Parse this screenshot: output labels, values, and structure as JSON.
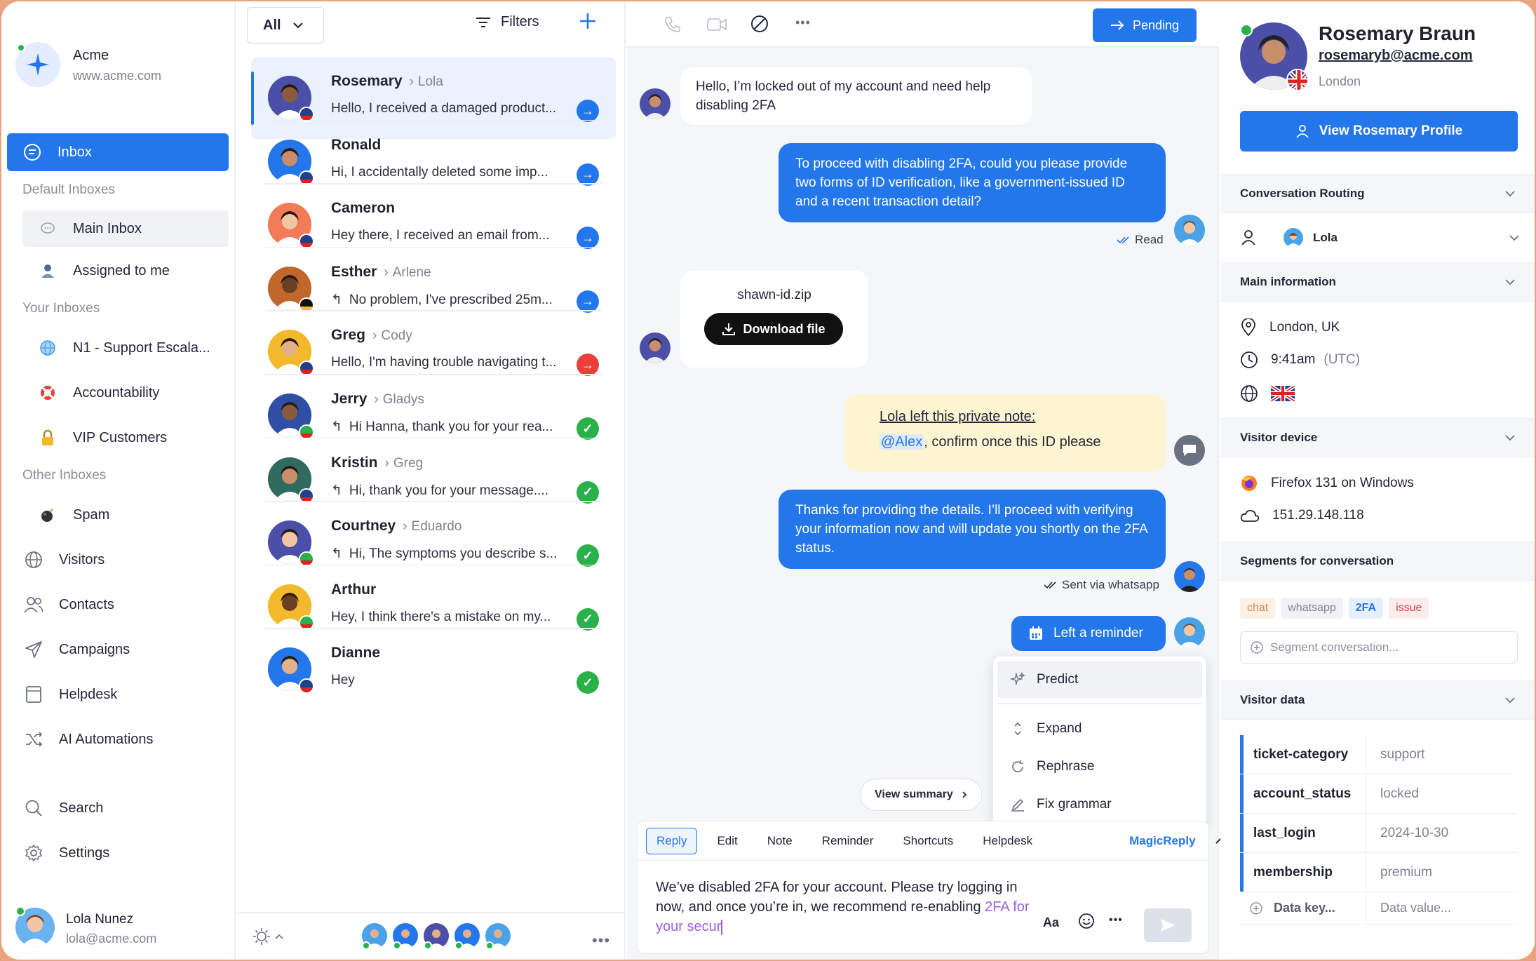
{
  "workspace": {
    "name": "Acme",
    "url": "www.acme.com"
  },
  "sidebar": {
    "inbox_label": "Inbox",
    "default_inboxes_title": "Default Inboxes",
    "main_inbox": "Main Inbox",
    "assigned_to_me": "Assigned to me",
    "your_inboxes_title": "Your Inboxes",
    "your_inboxes": [
      "N1 - Support Escala...",
      "Accountability",
      "VIP Customers"
    ],
    "other_inboxes_title": "Other Inboxes",
    "spam": "Spam",
    "nav": [
      "Visitors",
      "Contacts",
      "Campaigns",
      "Helpdesk",
      "AI Automations"
    ],
    "search": "Search",
    "settings": "Settings",
    "user": {
      "name": "Lola Nunez",
      "email": "lola@acme.com"
    }
  },
  "list": {
    "filter_value": "All",
    "filters_label": "Filters",
    "conversations": [
      {
        "name": "Rosemary",
        "agent": "Lola",
        "preview": "Hello, I received a damaged product...",
        "status": "arrow-blue",
        "reply": false
      },
      {
        "name": "Ronald",
        "agent": "",
        "preview": "Hi, I accidentally deleted some imp...",
        "status": "arrow-blue",
        "reply": false
      },
      {
        "name": "Cameron",
        "agent": "",
        "preview": "Hey there, I received an email from...",
        "status": "arrow-blue",
        "reply": false
      },
      {
        "name": "Esther",
        "agent": "Arlene",
        "preview": "No problem, I've prescribed 25m...",
        "status": "arrow-blue",
        "reply": true
      },
      {
        "name": "Greg",
        "agent": "Cody",
        "preview": "Hello, I'm having trouble navigating t...",
        "status": "arrow-red",
        "reply": false
      },
      {
        "name": "Jerry",
        "agent": "Gladys",
        "preview": "Hi Hanna, thank you for your rea...",
        "status": "check-green",
        "reply": true
      },
      {
        "name": "Kristin",
        "agent": "Greg",
        "preview": "Hi, thank you for your message....",
        "status": "check-green",
        "reply": true
      },
      {
        "name": "Courtney",
        "agent": "Eduardo",
        "preview": "Hi, The symptoms you describe s...",
        "status": "check-green",
        "reply": true
      },
      {
        "name": "Arthur",
        "agent": "",
        "preview": "Hey, I think there's a mistake on my...",
        "status": "check-green",
        "reply": false
      },
      {
        "name": "Dianne",
        "agent": "",
        "preview": "Hey",
        "status": "check-green",
        "reply": false
      }
    ]
  },
  "chat": {
    "pending_label": "Pending",
    "msg1": "Hello, I’m locked out of my account and need help disabling 2FA",
    "msg2": "To proceed with disabling 2FA, could you please provide two forms of ID verification, like a government-issued ID and a recent transaction detail?",
    "msg2_status": "Read",
    "file_name": "shawn-id.zip",
    "download_label": "Download file",
    "note_title": "Lola left this private note:",
    "note_mention": "@Alex",
    "note_text": ", confirm once this ID please",
    "msg3": "Thanks for providing the details. I’ll proceed with verifying your information now and will update you shortly on the 2FA status.",
    "msg3_status": "Sent via whatsapp",
    "reminder_label": "Left a reminder",
    "view_summary": "View summary",
    "menu": [
      "Predict",
      "Expand",
      "Rephrase",
      "Fix grammar"
    ],
    "tabs": [
      "Reply",
      "Edit",
      "Note",
      "Reminder",
      "Shortcuts",
      "Helpdesk"
    ],
    "magic_reply": "MagicReply",
    "composer_text": "We’ve disabled 2FA for your account. Please try logging in now, and once you’re in, we recommend re-enabling ",
    "composer_prediction": "2FA for your secur",
    "font_label": "Aa"
  },
  "profile": {
    "name": "Rosemary Braun",
    "email": "rosemaryb@acme.com",
    "city": "London",
    "view_profile": "View Rosemary Profile",
    "routing_title": "Conversation Routing",
    "routing_agent": "Lola",
    "main_info_title": "Main information",
    "location": "London, UK",
    "time": "9:41am",
    "timezone": "(UTC)",
    "device_title": "Visitor device",
    "browser": "Firefox 131 on Windows",
    "ip": "151.29.148.118",
    "segments_title": "Segments for conversation",
    "segments": [
      "chat",
      "whatsapp",
      "2FA",
      "issue"
    ],
    "segment_placeholder": "Segment conversation...",
    "visitor_data_title": "Visitor data",
    "visitor_data": [
      {
        "key": "ticket-category",
        "value": "support"
      },
      {
        "key": "account_status",
        "value": "locked"
      },
      {
        "key": "last_login",
        "value": "2024-10-30"
      },
      {
        "key": "membership",
        "value": "premium"
      }
    ],
    "data_key_placeholder": "Data key...",
    "data_value_placeholder": "Data value..."
  },
  "colors": {
    "accent": "#2377ea",
    "success": "#2bb14a",
    "danger": "#e9403a",
    "note_bg": "#fdf5d2",
    "frame": "#e9a37f"
  }
}
